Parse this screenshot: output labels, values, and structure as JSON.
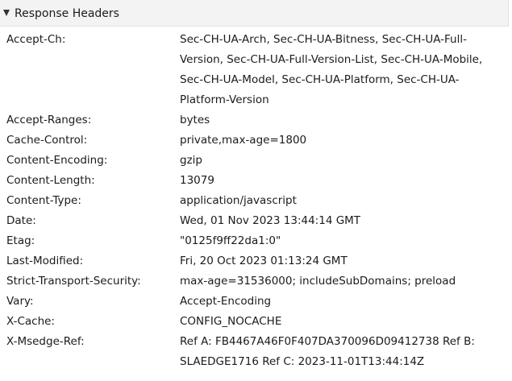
{
  "section": {
    "title": "Response Headers",
    "toggle_icon": "triangle-down-icon"
  },
  "headers": [
    {
      "name": "Accept-Ch:",
      "value": "Sec-CH-UA-Arch, Sec-CH-UA-Bitness, Sec-CH-UA-Full-Version, Sec-CH-UA-Full-Version-List, Sec-CH-UA-Mobile, Sec-CH-UA-Model, Sec-CH-UA-Platform, Sec-CH-UA-Platform-Version"
    },
    {
      "name": "Accept-Ranges:",
      "value": "bytes"
    },
    {
      "name": "Cache-Control:",
      "value": "private,max-age=1800"
    },
    {
      "name": "Content-Encoding:",
      "value": "gzip"
    },
    {
      "name": "Content-Length:",
      "value": "13079"
    },
    {
      "name": "Content-Type:",
      "value": "application/javascript"
    },
    {
      "name": "Date:",
      "value": "Wed, 01 Nov 2023 13:44:14 GMT"
    },
    {
      "name": "Etag:",
      "value": "\"0125f9ff22da1:0\""
    },
    {
      "name": "Last-Modified:",
      "value": "Fri, 20 Oct 2023 01:13:24 GMT"
    },
    {
      "name": "Strict-Transport-Security:",
      "value": "max-age=31536000; includeSubDomains; preload"
    },
    {
      "name": "Vary:",
      "value": "Accept-Encoding"
    },
    {
      "name": "X-Cache:",
      "value": "CONFIG_NOCACHE"
    },
    {
      "name": "X-Msedge-Ref:",
      "value": "Ref A: FB4467A46F0F407DA370096D09412738 Ref B: SLAEDGE1716 Ref C: 2023-11-01T13:44:14Z"
    }
  ]
}
